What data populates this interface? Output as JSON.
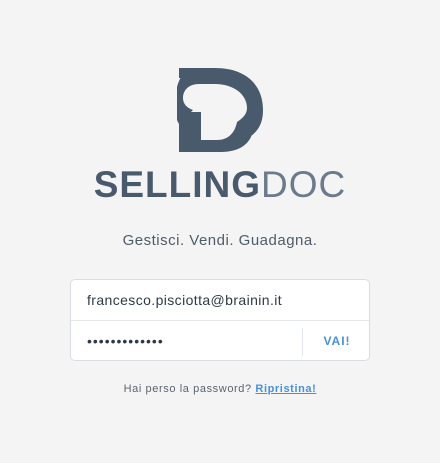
{
  "brand": {
    "logo_icon": "sellingdoc-s-logo-icon",
    "name_bold": "SELLING",
    "name_light": "DOC",
    "color": "#4a5a6d"
  },
  "tagline": "Gestisci. Vendi. Guadagna.",
  "login": {
    "email_value": "francesco.pisciotta@brainin.it",
    "password_value": "•••••••••••••",
    "submit_label": "VAI!"
  },
  "recovery": {
    "prompt": "Hai perso la password?",
    "link_label": "Ripristina!"
  },
  "colors": {
    "background": "#f4f4f5",
    "accent": "#4a90d9"
  }
}
